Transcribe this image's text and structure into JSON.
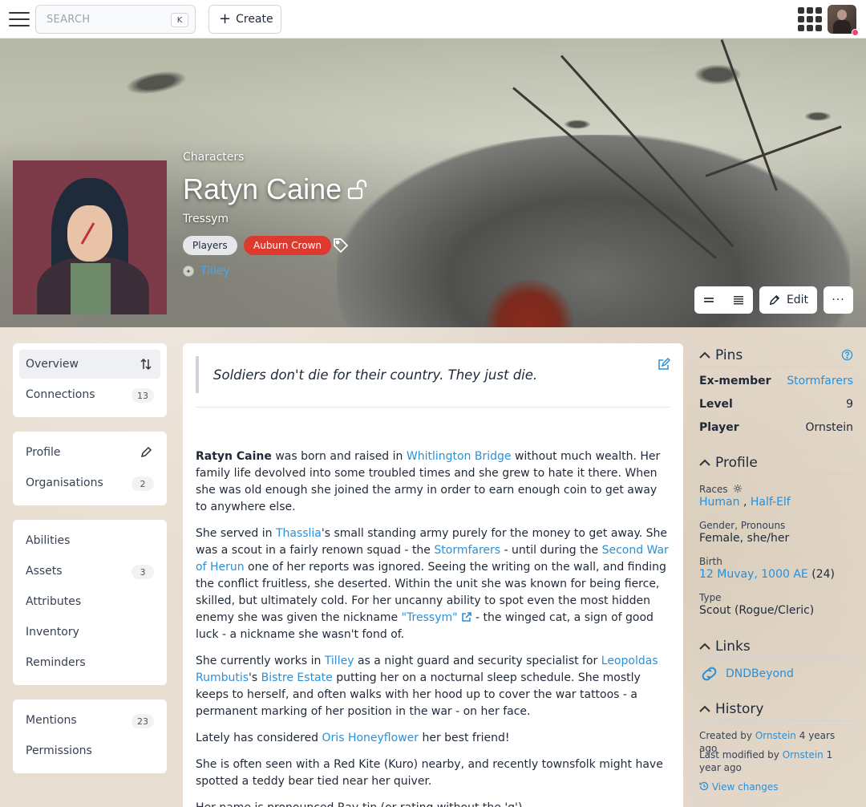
{
  "topnav": {
    "search_placeholder": "SEARCH",
    "search_shortcut": "K",
    "create_label": "Create"
  },
  "hero": {
    "breadcrumb": "Characters",
    "title": "Ratyn Caine",
    "subtitle": "Tressym",
    "tags": [
      "Players",
      "Auburn Crown"
    ],
    "location": "Tilley",
    "edit_label": "Edit",
    "more_label": "···"
  },
  "sidebar": {
    "group1": [
      {
        "label": "Overview"
      },
      {
        "label": "Connections",
        "count": "13"
      }
    ],
    "group2": [
      {
        "label": "Profile"
      },
      {
        "label": "Organisations",
        "count": "2"
      }
    ],
    "group3": [
      {
        "label": "Abilities"
      },
      {
        "label": "Assets",
        "count": "3"
      },
      {
        "label": "Attributes"
      },
      {
        "label": "Inventory"
      },
      {
        "label": "Reminders"
      }
    ],
    "group4": [
      {
        "label": "Mentions",
        "count": "23"
      },
      {
        "label": "Permissions"
      }
    ]
  },
  "main": {
    "quote": "Soldiers don't die for their country. They just die.",
    "p1": {
      "name": "Ratyn Caine",
      "t1": " was born and raised in ",
      "l1": "Whitlington Bridge",
      "t2": " without much wealth. Her family life devolved into some troubled times and she grew to hate it there. When she was old enough she joined the army in order to earn enough coin to get away to anywhere else."
    },
    "p2": {
      "t1": "She served in ",
      "l1": "Thasslia",
      "t2": "'s small standing army purely for the money to get away. She was a scout in a fairly renown squad - the ",
      "l2": "Stormfarers",
      "t3": " - until during the ",
      "l3": "Second War of Herun",
      "t4": " one of her reports was ignored. Seeing the writing on the wall, and finding the conflict fruitless, she deserted. Within the unit she was known for being fierce, skilled, but ultimately cold. For her uncanny ability to spot even the most hidden enemy she was given the nickname ",
      "l4": "\"Tressym\"",
      "t5": " -  the winged cat, a sign of good luck - a nickname she wasn't fond of."
    },
    "p3": {
      "t1": "She currently works in ",
      "l1": "Tilley",
      "t2": " as a night guard and security specialist for ",
      "l2": "Leopoldas Rumbutis",
      "t3": "'s ",
      "l3": "Bistre Estate",
      "t4": " putting her on a nocturnal sleep schedule. She mostly keeps to herself, and often walks with her hood up to cover the war tattoos - a permanent marking of her position in the war - on her face."
    },
    "p4": {
      "t1": "Lately has considered ",
      "l1": "Oris Honeyflower",
      "t2": " her best friend!"
    },
    "p5": "She is often seen with a Red Kite (Kuro) nearby, and recently townsfolk might have spotted a teddy bear tied near her quiver.",
    "p6": "Her name is pronounced Ray-tin (or rating without the 'g')"
  },
  "pins": {
    "heading": "Pins",
    "rows": [
      {
        "key": "Ex-member",
        "value": "Stormfarers"
      },
      {
        "key": "Level",
        "value": "9"
      },
      {
        "key": "Player",
        "value": "Ornstein"
      }
    ]
  },
  "profile": {
    "heading": "Profile",
    "races_label": "Races",
    "race1": "Human",
    "race_sep": ",",
    "race2": "Half-Elf",
    "gender_label": "Gender, Pronouns",
    "gender_value": "Female, she/her",
    "birth_label": "Birth",
    "birth_date": "12 Muvay, 1000 AE",
    "birth_age": "(24)",
    "type_label": "Type",
    "type_value": "Scout (Rogue/Cleric)"
  },
  "links": {
    "heading": "Links",
    "item": "DNDBeyond"
  },
  "history": {
    "heading": "History",
    "created_prefix": "Created by",
    "created_user": "Ornstein",
    "created_time": "4 years ago",
    "modified_prefix": "Last modified by",
    "modified_user": "Ornstein",
    "modified_time": "1 year ago",
    "view_changes": "View changes"
  },
  "colors": {
    "link": "#2b8fd6",
    "tag_crown": "#dc3a2f",
    "notification": "#ef476f"
  }
}
